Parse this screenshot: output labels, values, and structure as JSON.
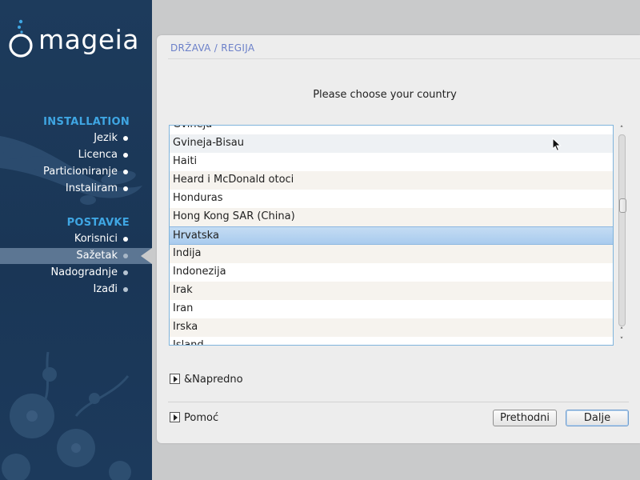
{
  "brand": {
    "logo_text": "mageia"
  },
  "sidebar": {
    "sections": [
      {
        "heading": "INSTALLATION",
        "items": [
          {
            "label": "Jezik",
            "state": "done"
          },
          {
            "label": "Licenca",
            "state": "done"
          },
          {
            "label": "Particioniranje",
            "state": "done"
          },
          {
            "label": "Instaliram",
            "state": "done"
          }
        ]
      },
      {
        "heading": "POSTAVKE",
        "items": [
          {
            "label": "Korisnici",
            "state": "done"
          },
          {
            "label": "Sažetak",
            "state": "current"
          },
          {
            "label": "Nadogradnje",
            "state": "todo"
          },
          {
            "label": "Izađi",
            "state": "todo"
          }
        ]
      }
    ]
  },
  "main": {
    "title": "DRŽAVA / REGIJA",
    "prompt": "Please choose your country",
    "countries": [
      "Gvineja",
      "Gvineja-Bisau",
      "Haiti",
      "Heard i McDonald otoci",
      "Honduras",
      "Hong Kong SAR (China)",
      "Hrvatska",
      "Indija",
      "Indonezija",
      "Irak",
      "Iran",
      "Irska",
      "Island"
    ],
    "selected_country": "Hrvatska",
    "scroll_position": 0.36,
    "advanced_label": "&Napredno",
    "help_label": "Pomoć",
    "buttons": {
      "previous": "Prethodni",
      "next": "Dalje"
    }
  },
  "colors": {
    "sidebar_bg": "#1d3b5c",
    "sidebar_heading": "#3fa6e3",
    "title_accent": "#6b80c9",
    "selection": "#a9cbee"
  },
  "icons": {
    "sidebar_dot": "bullet-icon",
    "expander": "triangle-right-icon",
    "scroll_up": "chevron-up-icon",
    "scroll_down": "chevron-down-icon"
  }
}
